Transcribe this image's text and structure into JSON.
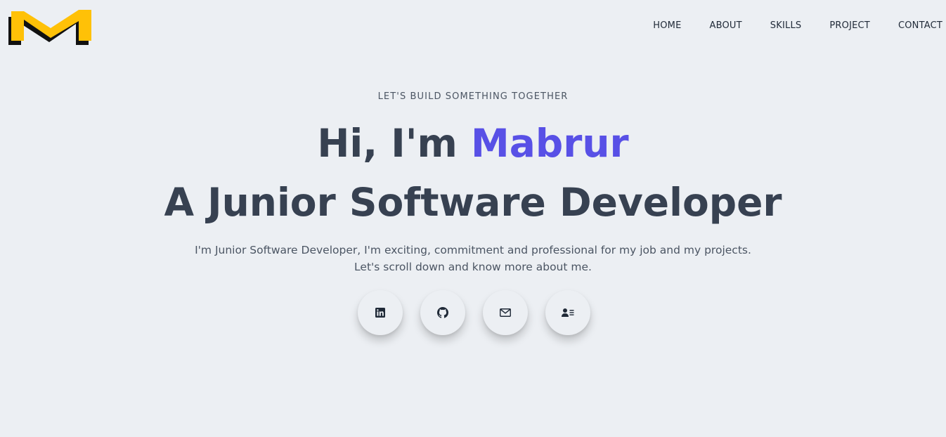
{
  "brand": {
    "logo_icon": "m-logo",
    "logo_color": "#ffc107"
  },
  "nav": {
    "items": [
      {
        "label": "HOME"
      },
      {
        "label": "ABOUT"
      },
      {
        "label": "SKILLS"
      },
      {
        "label": "PROJECT"
      },
      {
        "label": "CONTACT"
      }
    ]
  },
  "hero": {
    "eyebrow": "LET'S BUILD SOMETHING TOGETHER",
    "greeting": "Hi, I'm",
    "name": "Mabrur",
    "role": "A Junior Software Developer",
    "description_line1": "I'm Junior Software Developer, I'm exciting, commitment and professional for my job and my projects.",
    "description_line2": "Let's scroll down and know more about me."
  },
  "social": [
    {
      "icon": "linkedin-icon"
    },
    {
      "icon": "github-icon"
    },
    {
      "icon": "mail-icon"
    },
    {
      "icon": "contact-card-icon"
    }
  ],
  "colors": {
    "background": "#eceff3",
    "heading": "#374151",
    "accent": "#5850e6",
    "text": "#4b5563"
  }
}
